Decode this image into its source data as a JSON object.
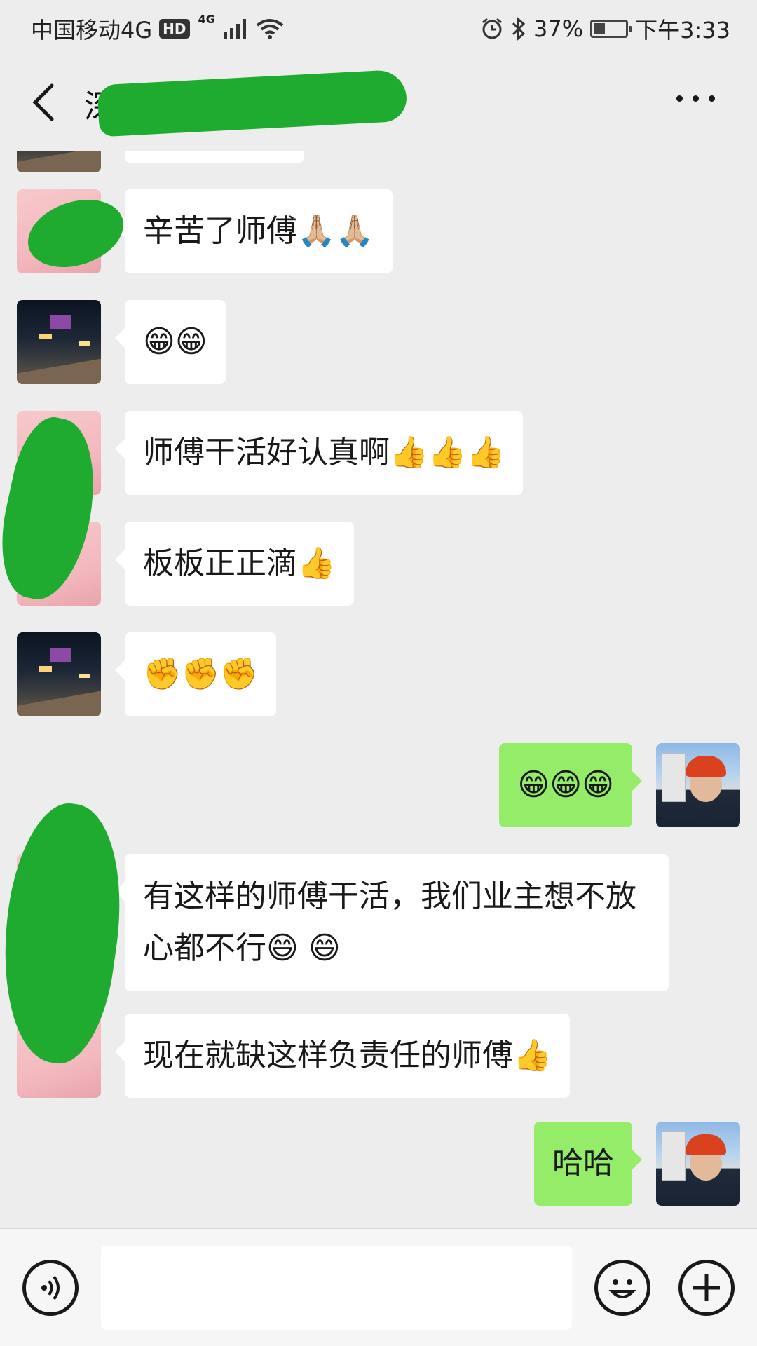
{
  "status_bar": {
    "carrier": "中国移动4G",
    "hd": "HD",
    "network": "4G",
    "battery": "37%",
    "battery_level": 0.37,
    "time": "下午3:33"
  },
  "header": {
    "title": "深港城",
    "more_icon": "more-dots-icon",
    "back_icon": "chevron-left-icon"
  },
  "messages": [
    {
      "side": "in",
      "sender": "contact-a",
      "text": "辛苦了师傅🙏🏼🙏🏼"
    },
    {
      "side": "in",
      "sender": "contact-b",
      "text": "😁😁"
    },
    {
      "side": "in",
      "sender": "contact-a",
      "text": "师傅干活好认真啊👍👍👍"
    },
    {
      "side": "in",
      "sender": "contact-a",
      "text": "板板正正滴👍"
    },
    {
      "side": "in",
      "sender": "contact-b",
      "text": "✊✊✊"
    },
    {
      "side": "out",
      "sender": "me",
      "text": "😁😁😁"
    },
    {
      "side": "in",
      "sender": "contact-c",
      "text": "有这样的师傅干活，我们业主想不放心都不行😄 😄"
    },
    {
      "side": "in",
      "sender": "contact-c",
      "text": "现在就缺这样负责任的师傅👍"
    },
    {
      "side": "out",
      "sender": "me",
      "text": "哈哈"
    }
  ],
  "input_bar": {
    "voice_icon": "voice-icon",
    "input_value": "",
    "emoji_icon": "emoji-icon",
    "plus_icon": "plus-icon"
  },
  "colors": {
    "background": "#ededed",
    "incoming_bubble": "#ffffff",
    "outgoing_bubble": "#95ec69",
    "redaction": "#1fab2f"
  }
}
